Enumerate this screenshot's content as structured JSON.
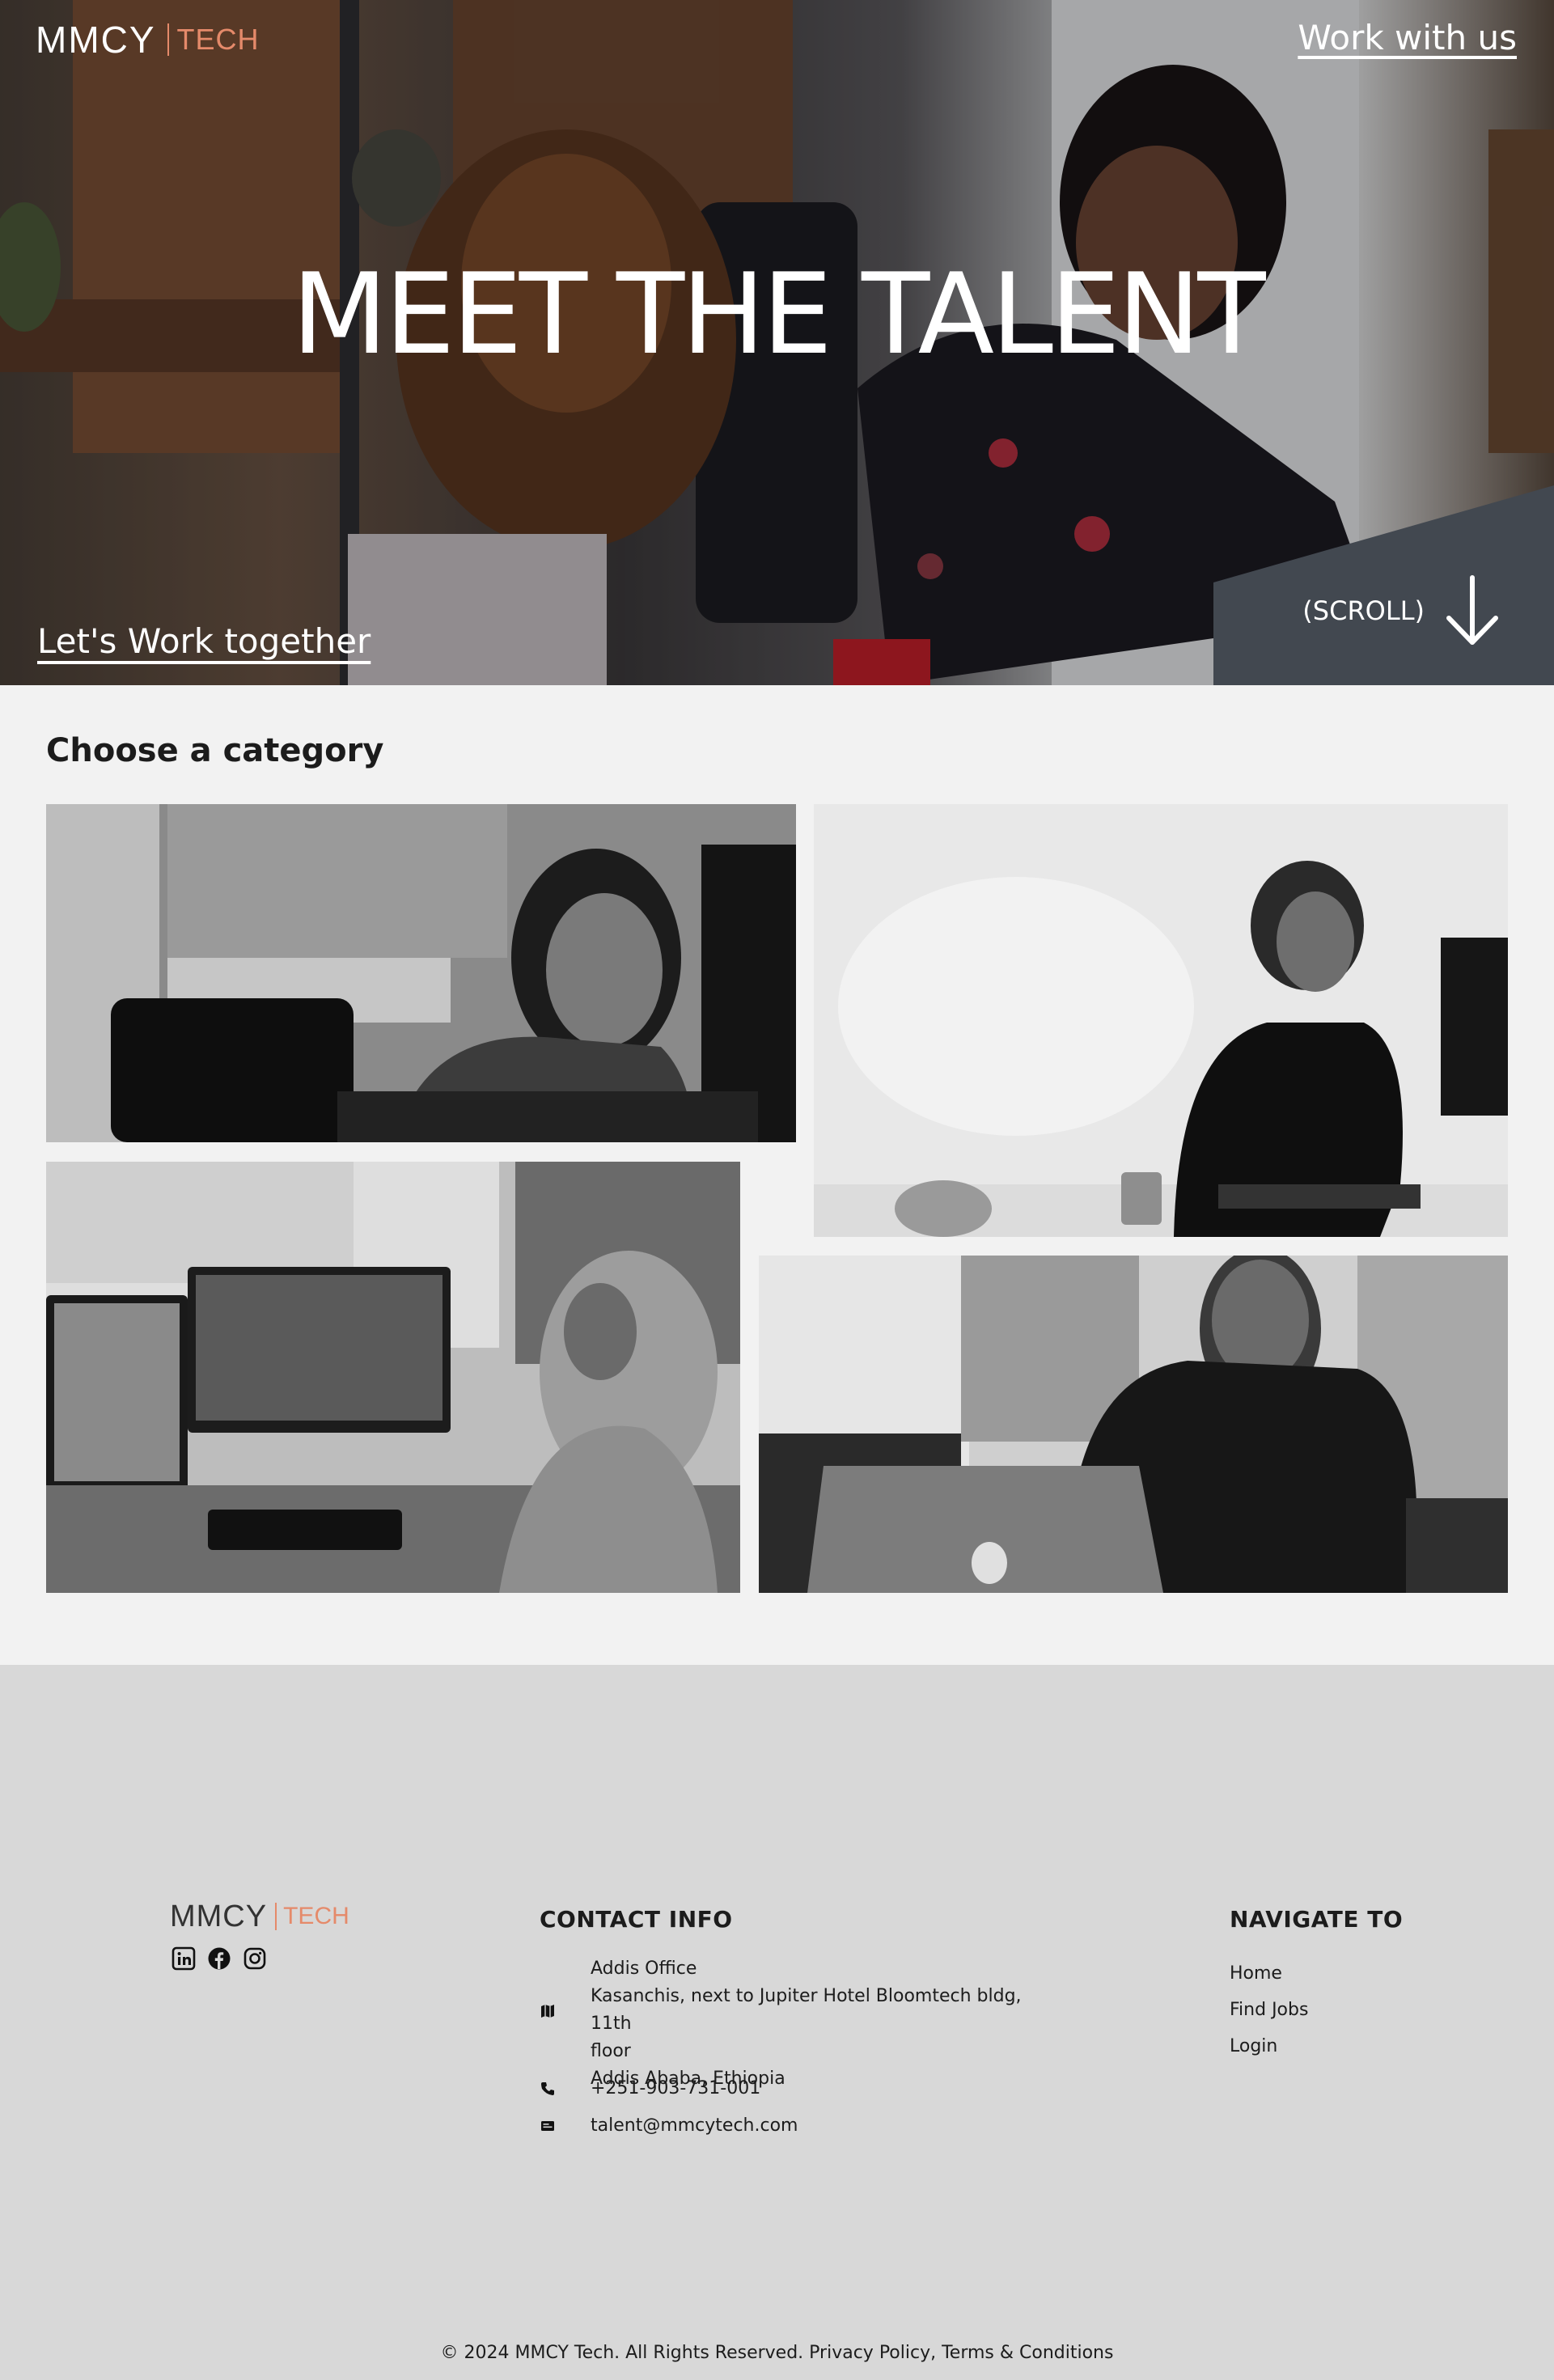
{
  "header": {
    "logo_primary": "MMCY",
    "logo_secondary": "TECH",
    "cta_link": "Work with us"
  },
  "hero": {
    "title": "MEET THE TALENT",
    "bottom_link": "Let's Work together",
    "scroll_label": "(SCROLL)",
    "scroll_icon": "arrow-down-icon"
  },
  "categories": {
    "heading": "Choose a category",
    "tiles": [
      {
        "image": "woman-with-headset-photo"
      },
      {
        "image": "man-with-headset-standing-photo"
      },
      {
        "image": "woman-in-hijab-with-headset-photo"
      },
      {
        "image": "man-with-laptop-photo"
      }
    ]
  },
  "footer": {
    "logo_primary": "MMCY",
    "logo_secondary": "TECH",
    "social_icons": [
      "linkedin-icon",
      "facebook-icon",
      "instagram-icon"
    ],
    "contact_heading": "CONTACT INFO",
    "address_lines": [
      "Addis Office",
      "Kasanchis, next to Jupiter Hotel Bloomtech bldg, 11th",
      "floor",
      "Addis Ababa, Ethiopia"
    ],
    "phone": "+251-903-731-001",
    "email": "talent@mmcytech.com",
    "nav_heading": "NAVIGATE TO",
    "nav_items": [
      "Home",
      "Find Jobs",
      "Login"
    ],
    "copyright": "© 2024 MMCY Tech. All Rights Reserved. Privacy Policy, Terms & Conditions"
  },
  "colors": {
    "brand_accent": "#e58a6a",
    "page_bg": "#f2f2f2",
    "footer_bg": "#d8d8d8"
  }
}
